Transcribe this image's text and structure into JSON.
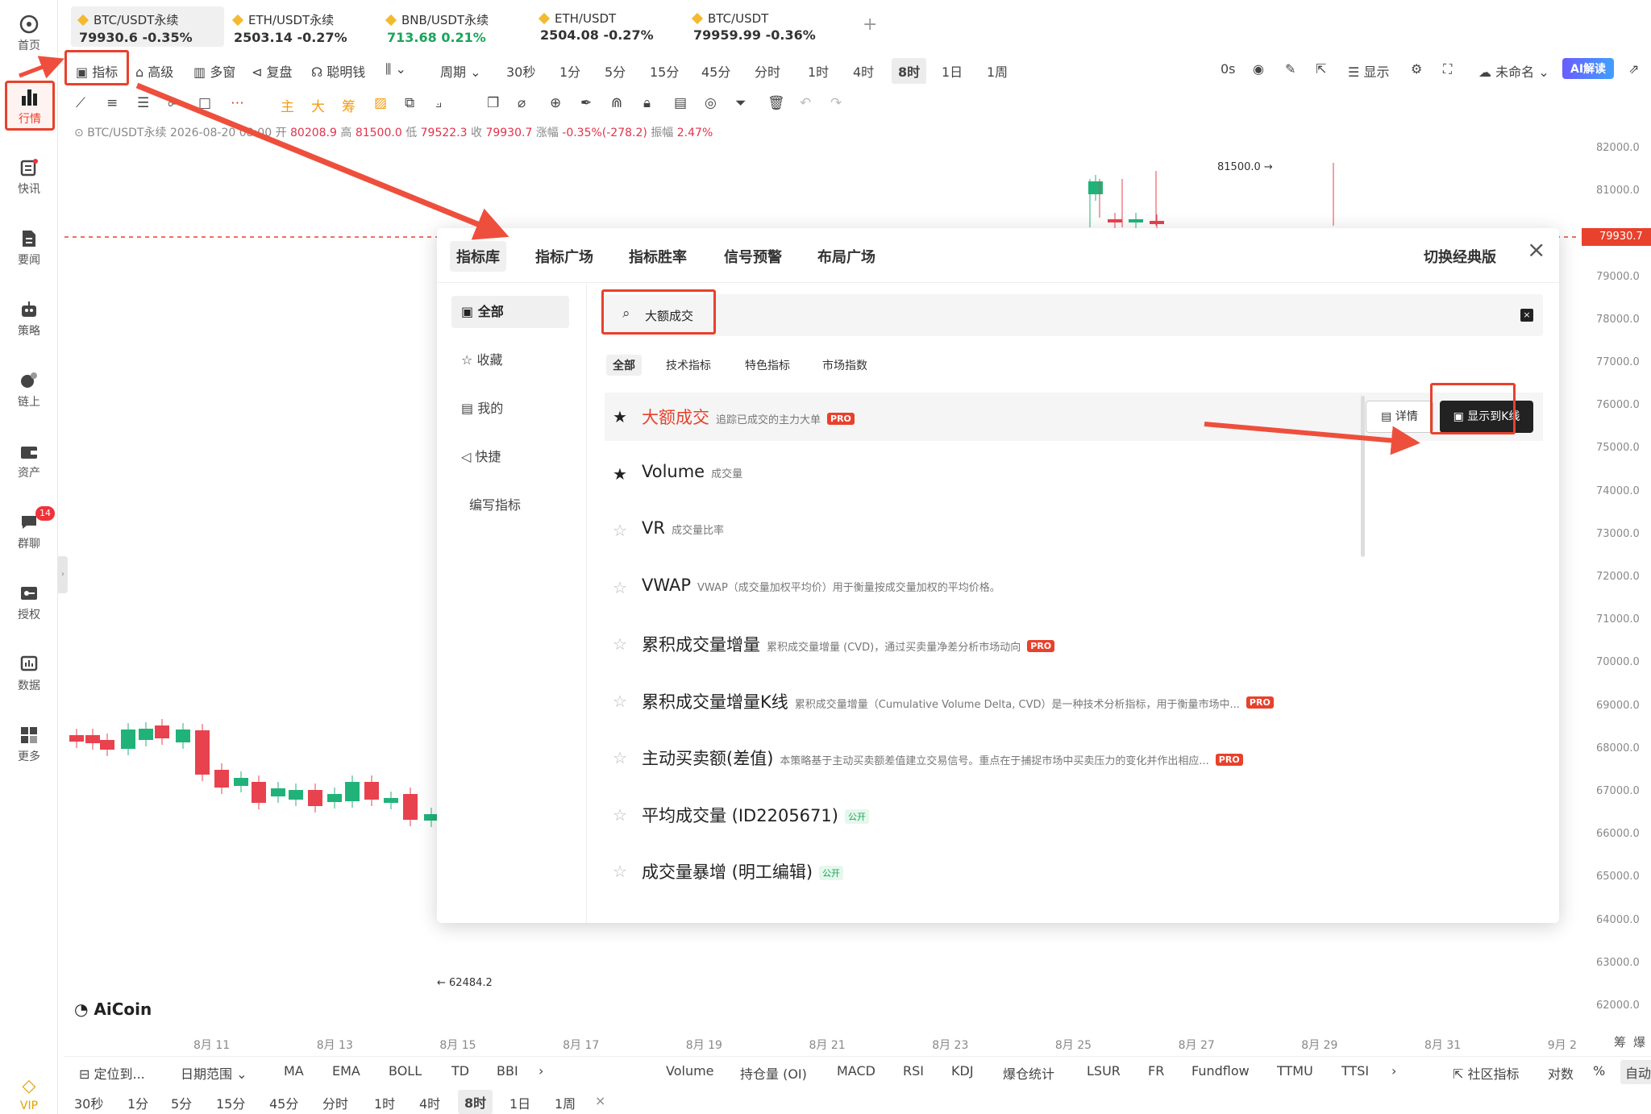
{
  "sidebar": {
    "items": [
      {
        "label": "首页",
        "icon": "aicoin-logo-icon"
      },
      {
        "label": "行情",
        "icon": "bar-chart-icon"
      },
      {
        "label": "快讯",
        "icon": "news-icon"
      },
      {
        "label": "要闻",
        "icon": "document-icon"
      },
      {
        "label": "策略",
        "icon": "robot-icon"
      },
      {
        "label": "链上",
        "icon": "chain-icon"
      },
      {
        "label": "资产",
        "icon": "wallet-icon"
      },
      {
        "label": "群聊",
        "icon": "chat-icon",
        "badge": "14"
      },
      {
        "label": "授权",
        "icon": "key-icon"
      },
      {
        "label": "数据",
        "icon": "data-icon"
      },
      {
        "label": "更多",
        "icon": "grid-icon"
      }
    ],
    "vip": "VIP"
  },
  "symbols": [
    {
      "name": "BTC/USDT永续",
      "price": "79930.6",
      "change": "-0.35%",
      "color": "#e0334b"
    },
    {
      "name": "ETH/USDT永续",
      "price": "2503.14",
      "change": "-0.27%",
      "color": "#333333"
    },
    {
      "name": "BNB/USDT永续",
      "price": "713.68",
      "change": "0.21%",
      "color": "#18a55a"
    },
    {
      "name": "ETH/USDT",
      "price": "2504.08",
      "change": "-0.27%",
      "color": "#333333"
    },
    {
      "name": "BTC/USDT",
      "price": "79959.99",
      "change": "-0.36%",
      "color": "#333333"
    }
  ],
  "toolbar": {
    "indicator": "指标",
    "advanced": "高级",
    "multiwindow": "多窗",
    "replay": "复盘",
    "smartmoney": "聪明钱",
    "period": "周期",
    "intervals": [
      "30秒",
      "1分",
      "5分",
      "15分",
      "45分",
      "分时",
      "1时",
      "4时",
      "8时",
      "1日",
      "1周"
    ],
    "active_interval": "8时",
    "zero_s": "0s",
    "display": "显示",
    "unnamed": "未命名",
    "ai": "AI解读"
  },
  "drawtools": [
    "主",
    "大",
    "筹"
  ],
  "info": {
    "symbol": "BTC/USDT永续",
    "date": "2026-08-20 08:00",
    "open_l": "开",
    "open": "80208.9",
    "high_l": "高",
    "high": "81500.0",
    "low_l": "低",
    "low": "79522.3",
    "close_l": "收",
    "close": "79930.7",
    "chg_l": "涨幅",
    "chg": "-0.35%(-278.2)",
    "amp_l": "振幅",
    "amp": "2.47%"
  },
  "yaxis": [
    "82000.0",
    "81000.0",
    "80000.0",
    "79000.0",
    "78000.0",
    "77000.0",
    "76000.0",
    "75000.0",
    "74000.0",
    "73000.0",
    "72000.0",
    "71000.0",
    "70000.0",
    "69000.0",
    "68000.0",
    "67000.0",
    "66000.0",
    "65000.0",
    "64000.0",
    "63000.0",
    "62000.0"
  ],
  "price_tag": "79930.7",
  "high_mark": "81500.0 →",
  "low_mark": "← 62484.2",
  "xaxis": [
    "8月 11",
    "8月 13",
    "8月 15",
    "8月 17",
    "8月 19",
    "8月 21",
    "8月 23",
    "8月 25",
    "8月 27",
    "8月 29",
    "8月 31",
    "9月 2"
  ],
  "logo": "AiCoin",
  "corner": [
    "筹",
    "爆"
  ],
  "bottom1": {
    "locate": "定位到...",
    "daterange": "日期范围",
    "left": [
      "MA",
      "EMA",
      "BOLL",
      "TD",
      "BBI"
    ],
    "right": [
      "Volume",
      "持仓量 (OI)",
      "MACD",
      "RSI",
      "KDJ",
      "爆仓统计",
      "LSUR",
      "FR",
      "Fundflow",
      "TTMU",
      "TTSI"
    ],
    "community": "社区指标",
    "log": "对数",
    "pct": "%",
    "auto": "自动"
  },
  "bottom2": {
    "intervals": [
      "30秒",
      "1分",
      "5分",
      "15分",
      "45分",
      "分时",
      "1时",
      "4时",
      "8时",
      "1日",
      "1周"
    ],
    "close": "×"
  },
  "modal": {
    "tabs": [
      "指标库",
      "指标广场",
      "指标胜率",
      "信号预警",
      "布局广场"
    ],
    "switch": "切换经典版",
    "close": "×",
    "left": [
      "全部",
      "收藏",
      "我的",
      "快捷",
      "编写指标"
    ],
    "search": "大额成交",
    "filters": [
      "全部",
      "技术指标",
      "特色指标",
      "市场指数"
    ],
    "rows": [
      {
        "name": "大额成交",
        "desc": "追踪已成交的主力大单",
        "tag": "PRO",
        "star": true,
        "red": true
      },
      {
        "name": "Volume",
        "desc": "成交量",
        "tag": "",
        "star": true
      },
      {
        "name": "VR",
        "desc": "成交量比率",
        "tag": "",
        "star": false
      },
      {
        "name": "VWAP",
        "desc": "VWAP（成交量加权平均价）用于衡量按成交量加权的平均价格。",
        "tag": "",
        "star": false
      },
      {
        "name": "累积成交量增量",
        "desc": "累积成交量增量 (CVD)，通过买卖量净差分析市场动向",
        "tag": "PRO",
        "star": false
      },
      {
        "name": "累积成交量增量K线",
        "desc": "累积成交量增量（Cumulative Volume Delta, CVD）是一种技术分析指标，用于衡量市场中...",
        "tag": "PRO",
        "star": false
      },
      {
        "name": "主动买卖额(差值)",
        "desc": "本策略基于主动买卖额差值建立交易信号。重点在于捕捉市场中买卖压力的变化并作出相应...",
        "tag": "PRO",
        "star": false
      },
      {
        "name": "平均成交量 (ID2205671)",
        "desc": "",
        "tag": "公开",
        "star": false
      },
      {
        "name": "成交量暴增 (明工编辑)",
        "desc": "",
        "tag": "公开",
        "star": false
      }
    ],
    "detail": "详情",
    "show_k": "显示到K线"
  }
}
